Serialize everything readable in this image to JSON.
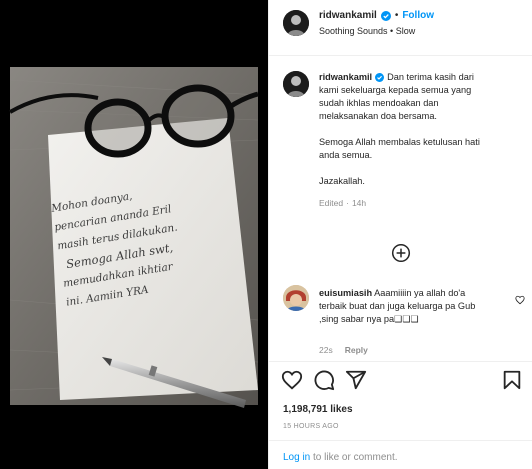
{
  "post": {
    "username": "ridwankamil",
    "verified": true,
    "follow_label": "Follow",
    "separator": "•",
    "audio": "Soothing Sounds • Slow",
    "caption_line1": "Dan terima kasih dari",
    "caption_line2": "kami sekeluarga kepada semua yang",
    "caption_line3": "sudah ikhlas mendoakan dan",
    "caption_line4": "melaksanakan doa bersama.",
    "caption_line5": "Semoga Allah membalas ketulusan hati",
    "caption_line6": "anda semua.",
    "caption_line7": "Jazakallah.",
    "edited_label": "Edited",
    "separator2": "·",
    "time": "14h"
  },
  "note": {
    "line1": "Mohon doanya,",
    "line2": "pencarian ananda Eril",
    "line3": "masih terus dilakukan.",
    "line4": "Semoga Allah swt,",
    "line5": "memudahkan ikhtiar",
    "line6": "ini. Aamiin YRA"
  },
  "comments": [
    {
      "username": "euisumiasih",
      "text_line1": "Aaamiiiin ya allah do'a",
      "text_line2": "terbaik buat dan juga keluarga pa Gub",
      "text_line3": ",sing sabar nya pa❑❑❑",
      "time": "22s",
      "reply_label": "Reply"
    }
  ],
  "actions": {
    "like_icon": "heart-icon",
    "comment_icon": "comment-icon",
    "share_icon": "share-icon",
    "save_icon": "bookmark-icon"
  },
  "likes_text": "1,198,791 likes",
  "timestamp": "15 HOURS AGO",
  "footer": {
    "login_label": "Log in",
    "rest": " to like or comment."
  },
  "colors": {
    "accent": "#0095f6",
    "muted": "#8e8e8e",
    "text": "#262626",
    "border": "#efefef"
  }
}
